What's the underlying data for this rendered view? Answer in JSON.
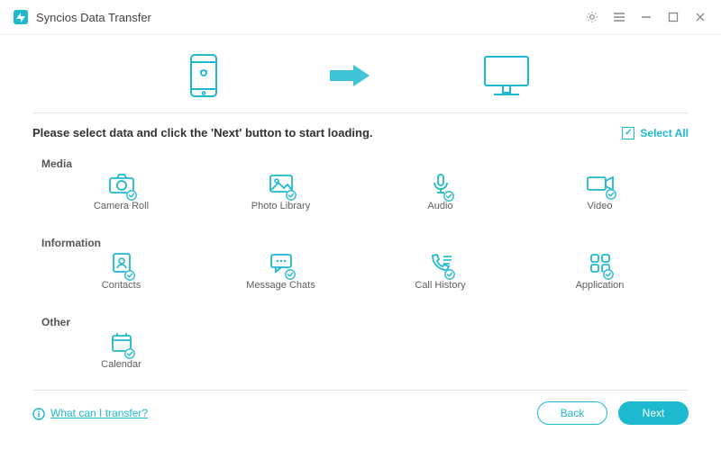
{
  "app": {
    "title": "Syncios Data Transfer"
  },
  "window_buttons": {
    "settings": "settings-icon",
    "menu": "menu-icon",
    "minimize": "minimize-icon",
    "maximize": "maximize-icon",
    "close": "close-icon"
  },
  "devices": {
    "source": "android-phone-icon",
    "target": "desktop-computer-icon"
  },
  "instruction": "Please select data and click the 'Next' button to start loading.",
  "select_all": {
    "label": "Select All",
    "checked": true
  },
  "groups": [
    {
      "key": "media",
      "label": "Media",
      "items": [
        {
          "key": "camera_roll",
          "label": "Camera Roll",
          "icon": "camera-roll-icon"
        },
        {
          "key": "photo_library",
          "label": "Photo Library",
          "icon": "photo-library-icon"
        },
        {
          "key": "audio",
          "label": "Audio",
          "icon": "audio-icon"
        },
        {
          "key": "video",
          "label": "Video",
          "icon": "video-icon"
        }
      ]
    },
    {
      "key": "information",
      "label": "Information",
      "items": [
        {
          "key": "contacts",
          "label": "Contacts",
          "icon": "contacts-icon"
        },
        {
          "key": "message_chats",
          "label": "Message Chats",
          "icon": "message-chats-icon"
        },
        {
          "key": "call_history",
          "label": "Call History",
          "icon": "call-history-icon"
        },
        {
          "key": "application",
          "label": "Application",
          "icon": "application-icon"
        }
      ]
    },
    {
      "key": "other",
      "label": "Other",
      "items": [
        {
          "key": "calendar",
          "label": "Calendar",
          "icon": "calendar-icon"
        }
      ]
    }
  ],
  "help_link": "What can I transfer?",
  "buttons": {
    "back": "Back",
    "next": "Next"
  },
  "colors": {
    "accent": "#1DBACF"
  }
}
